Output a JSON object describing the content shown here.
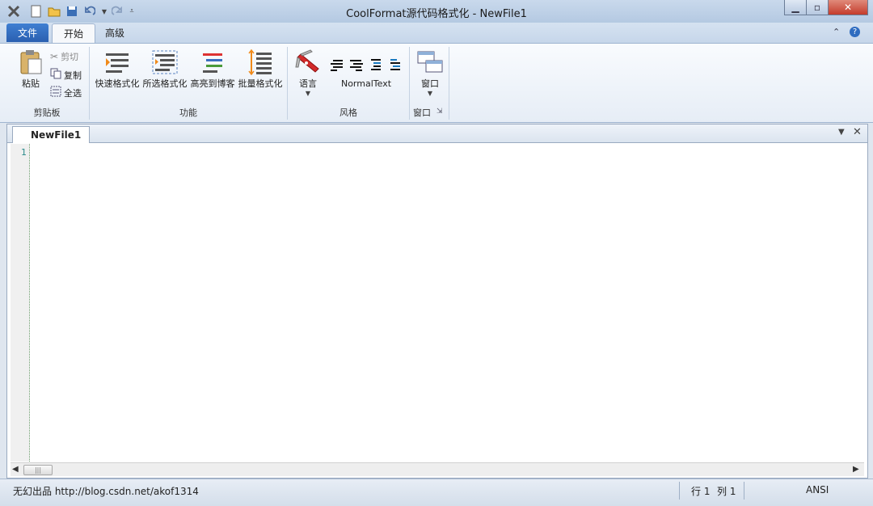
{
  "window": {
    "title": "CoolFormat源代码格式化 - NewFile1"
  },
  "ribbon_tabs": [
    "文件",
    "开始",
    "高级"
  ],
  "groups": {
    "clipboard": {
      "label": "剪贴板",
      "paste": "粘贴",
      "cut": "剪切",
      "copy": "复制",
      "select_all": "全选"
    },
    "function": {
      "label": "功能",
      "quick_format": "快速格式化",
      "selected_format": "所选格式化",
      "highlight_blog": "高亮到博客",
      "batch_format": "批量格式化"
    },
    "style": {
      "label": "风格",
      "language": "语言",
      "style_name": "NormalText"
    },
    "window": {
      "label": "窗口",
      "window_btn": "窗口"
    }
  },
  "document": {
    "tab_name": "NewFile1",
    "line_number": "1"
  },
  "status": {
    "credit": "无幻出品 http://blog.csdn.net/akof1314",
    "row": "行 1",
    "col": "列 1",
    "encoding": "ANSI"
  },
  "colors": {
    "accent": "#2a5fb0",
    "ribbon_bg": "#f9fbfe",
    "close_red": "#c43c2c"
  }
}
